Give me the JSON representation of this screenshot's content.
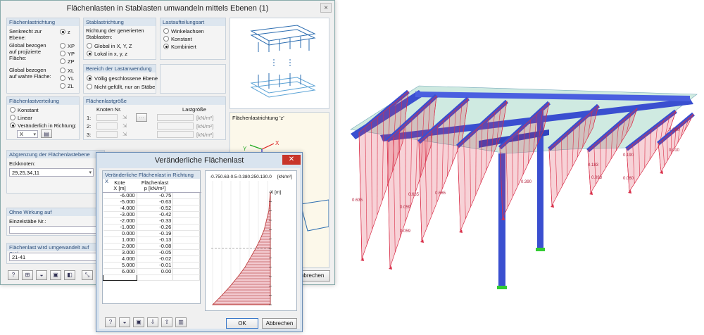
{
  "main_dialog": {
    "title": "Flächenlasten in Stablasten umwandeln mittels Ebenen   (1)",
    "close": "×"
  },
  "g1": {
    "header": "Flächenlastrichtung",
    "perp": "Senkrecht zur Ebene:",
    "proj": "Global bezogen auf projizierte Fläche:",
    "true_area": "Global bezogen auf wahre Fläche:",
    "opt_z": "z",
    "opt_xp": "XP",
    "opt_yp": "YP",
    "opt_zp": "ZP",
    "opt_xl": "XL",
    "opt_yl": "YL",
    "opt_zl": "ZL"
  },
  "g2": {
    "header": "Stablastrichtung",
    "desc": "Richtung der generierten Stablasten:",
    "opt_global": "Global in X, Y, Z",
    "opt_local": "Lokal in x, y, z"
  },
  "g3": {
    "header": "Lastaufteilungsart",
    "opt_angle": "Winkelachsen",
    "opt_const": "Konstant",
    "opt_comb": "Kombiniert"
  },
  "g4": {
    "header": "Bereich der Lastanwendung",
    "opt_closed": "Völlig geschlossene Ebene",
    "opt_notfilled": "Nicht gefüllt, nur an Stäbe"
  },
  "g5": {
    "header": "Flächenlastverteilung",
    "opt_const": "Konstant",
    "opt_linear": "Linear",
    "opt_var": "Veränderlich in Richtung:",
    "dir_value": "X"
  },
  "g6": {
    "header": "Flächenlastgröße",
    "nodes": "Knoten Nr.",
    "size": "Lastgröße",
    "r1": "1:",
    "r2": "2:",
    "r3": "3:",
    "unit": "[kN/m²]"
  },
  "preview2_label": "Flächenlastrichtung 'z'",
  "g7": {
    "header": "Abgrenzung der Flächenlastebene",
    "corner_label": "Eckknoten:",
    "corner_value": "29,25,34,11"
  },
  "g8": {
    "header": "Ohne Wirkung auf",
    "single_label": "Einzelstäbe Nr.:"
  },
  "g9": {
    "header": "Flächenlast wird umgewandelt auf Stäbe",
    "value": "21-41"
  },
  "main_cancel": "Abbrechen",
  "var_dialog": {
    "title": "Veränderliche Flächenlast",
    "close": "✕",
    "table_header": "Veränderliche Flächenlast in Richtung X",
    "col1a": "Kote",
    "col1b": "X [m]",
    "col2a": "Flächenlast",
    "col2b": "p [kN/m²]",
    "ok": "OK",
    "cancel": "Abbrechen",
    "plot_unit": "[kN/m²]",
    "plot_axis": "X [m]",
    "plot_top": "-0.750.63-0.5-0.380.250.130.0"
  },
  "table_rows": [
    [
      "-6.000",
      "-0.75"
    ],
    [
      "-5.000",
      "-0.63"
    ],
    [
      "-4.000",
      "-0.52"
    ],
    [
      "-3.000",
      "-0.42"
    ],
    [
      "-2.000",
      "-0.33"
    ],
    [
      "-1.000",
      "-0.26"
    ],
    [
      "0.000",
      "-0.19"
    ],
    [
      "1.000",
      "-0.13"
    ],
    [
      "2.000",
      "-0.08"
    ],
    [
      "3.000",
      "-0.05"
    ],
    [
      "4.000",
      "-0.02"
    ],
    [
      "5.000",
      "-0.01"
    ],
    [
      "6.000",
      "0.00"
    ],
    [
      "",
      ""
    ]
  ],
  "model_labels": [
    "0.090",
    "0.010",
    "0.190",
    "0.183",
    "0.060",
    "0.390",
    "0.635",
    "0.059",
    "0.665",
    "0.635",
    "0.059",
    "0.093"
  ],
  "colors": {
    "load": "#d9304a",
    "steel": "#3a4fd0",
    "slab": "#a8d8c8"
  }
}
